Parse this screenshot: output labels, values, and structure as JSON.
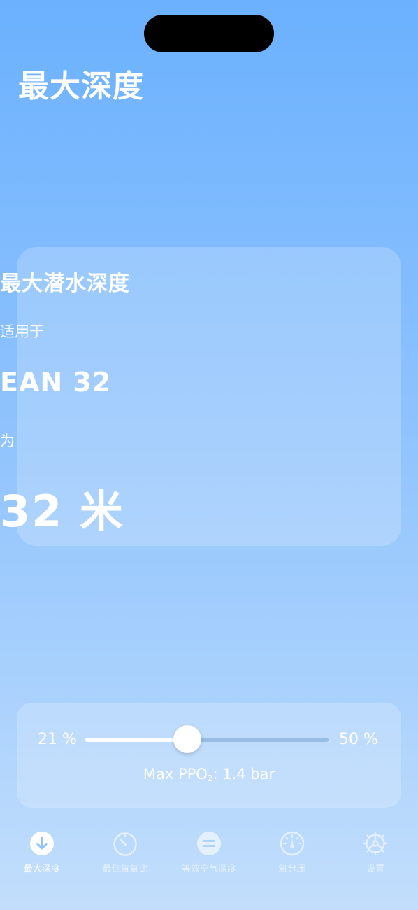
{
  "header": {
    "title": "最大深度"
  },
  "result": {
    "heading": "最大潜水深度",
    "for_label": "适用于",
    "mix": "EAN 32",
    "is_label": "为",
    "depth": "32 米"
  },
  "slider": {
    "min_label": "21 %",
    "max_label": "50 %",
    "value_fraction": 0.42,
    "ppo2_prefix": "Max PPO",
    "ppo2_sub": "2",
    "ppo2_suffix": ": 1.4 bar"
  },
  "tabs": [
    {
      "label": "最大深度",
      "icon": "arrow-down-circle-icon",
      "active": true
    },
    {
      "label": "最佳氧氧比",
      "icon": "timer-icon",
      "active": false
    },
    {
      "label": "等效空气深度",
      "icon": "equal-circle-icon",
      "active": false
    },
    {
      "label": "氧分压",
      "icon": "gauge-icon",
      "active": false
    },
    {
      "label": "设置",
      "icon": "gear-icon",
      "active": false
    }
  ],
  "colors": {
    "bg_top": "#6bb1fe",
    "bg_bottom": "#c3defc",
    "text": "#ffffff"
  }
}
